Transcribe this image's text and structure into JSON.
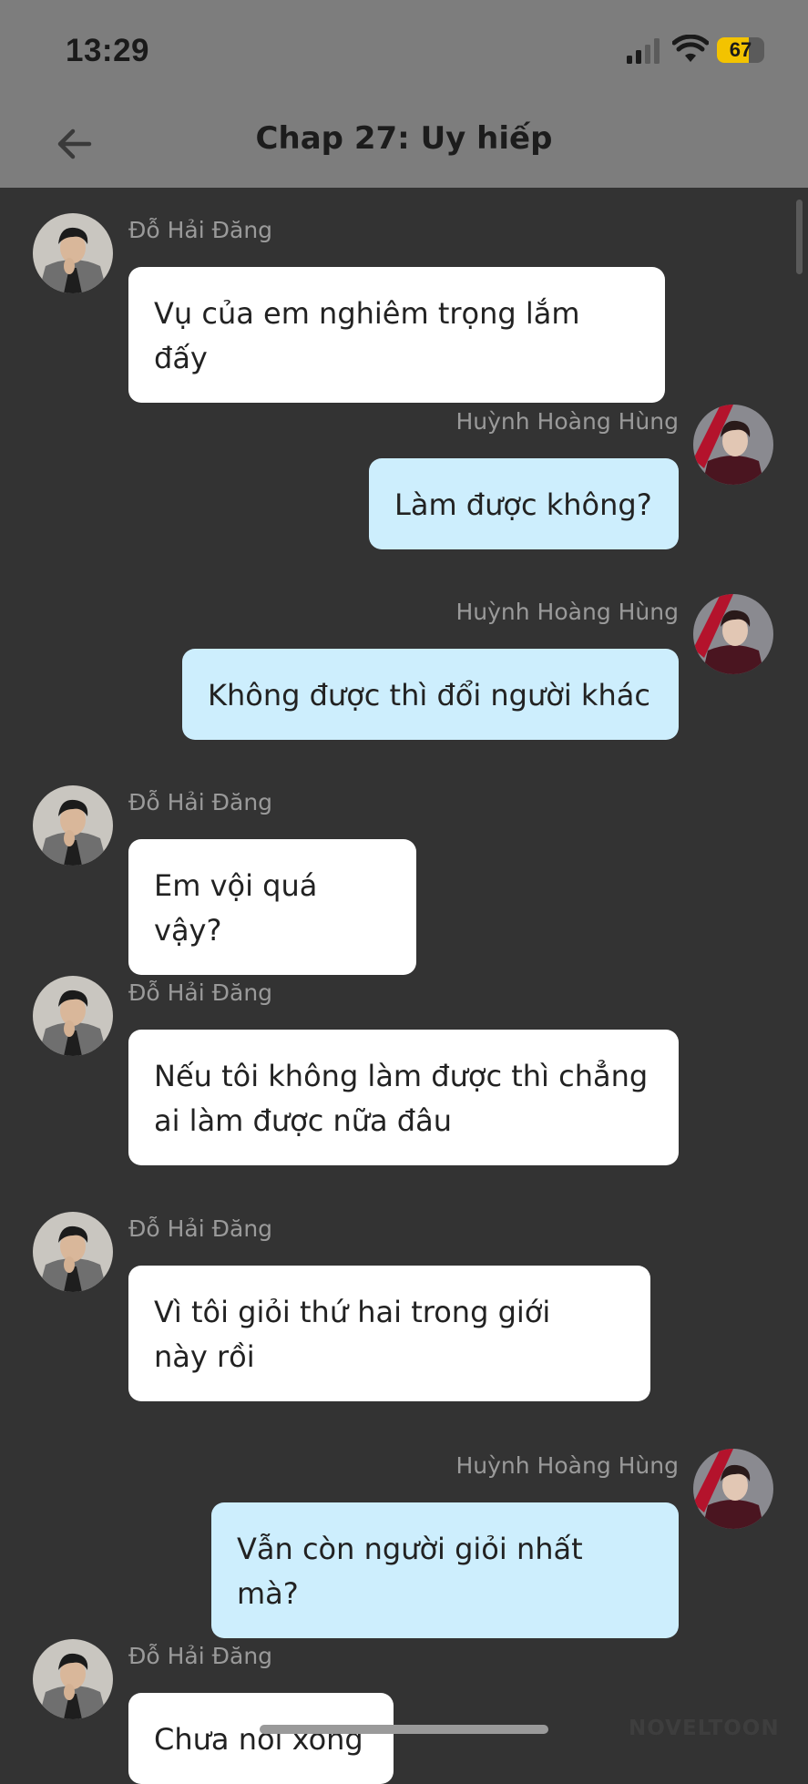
{
  "status_bar": {
    "time": "13:29",
    "battery_level": "67",
    "battery_fraction": 0.67
  },
  "header": {
    "title": "Chap 27: Uy hiếp"
  },
  "colors": {
    "background": "#333333",
    "header_bg": "#7d7d7d",
    "bubble_left": "#ffffff",
    "bubble_right": "#cdeefd",
    "battery_accent": "#f3c300"
  },
  "icons": {
    "back": "arrow-left-icon",
    "signal": "cellular-signal-icon",
    "wifi": "wifi-icon",
    "battery": "battery-icon"
  },
  "messages": [
    {
      "sender": "Đỗ Hải Đăng",
      "side": "left",
      "text": "Vụ của em nghiêm trọng lắm đấy"
    },
    {
      "sender": "Huỳnh Hoàng Hùng",
      "side": "right",
      "text": "Làm được không?"
    },
    {
      "sender": "Huỳnh Hoàng Hùng",
      "side": "right",
      "text": "Không được thì đổi người khác"
    },
    {
      "sender": "Đỗ Hải Đăng",
      "side": "left",
      "text": "Em vội quá vậy?"
    },
    {
      "sender": "Đỗ Hải Đăng",
      "side": "left",
      "text": "Nếu tôi không làm được thì chẳng\nai làm được nữa đâu"
    },
    {
      "sender": "Đỗ Hải Đăng",
      "side": "left",
      "text": "Vì tôi giỏi thứ hai trong giới\nnày rồi"
    },
    {
      "sender": "Huỳnh Hoàng Hùng",
      "side": "right",
      "text": "Vẫn còn người giỏi nhất mà?"
    },
    {
      "sender": "Đỗ Hải Đăng",
      "side": "left",
      "text": "Chưa nói xong"
    }
  ],
  "watermark": "NOVELTOON"
}
